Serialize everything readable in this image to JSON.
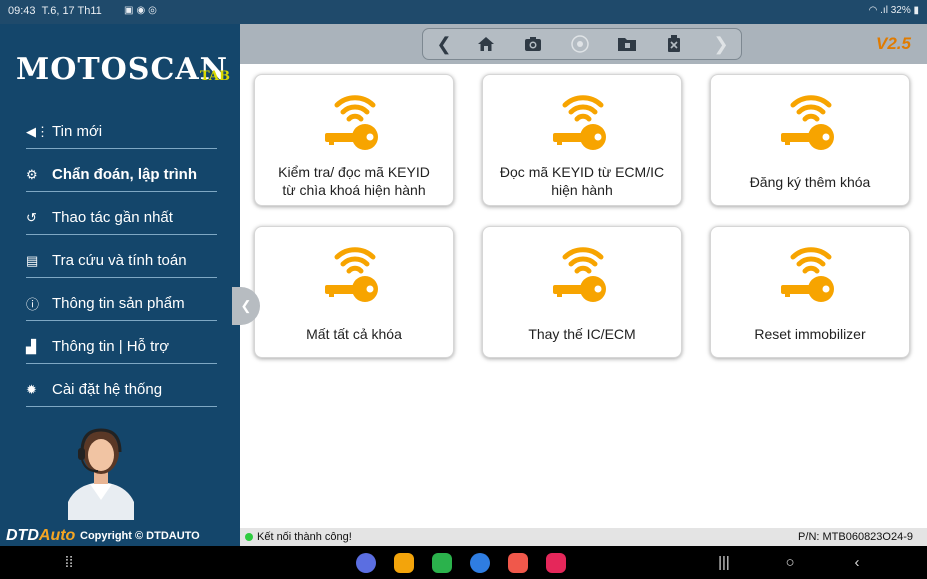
{
  "status_bar": {
    "time": "09:43",
    "date": "T.6, 17 Th11",
    "icons": [
      "image-icon",
      "shield-icon",
      "chrome-icon"
    ],
    "battery": "32%"
  },
  "sidebar": {
    "logo": "MOTOSCAN",
    "logo_sub": "TAB",
    "items": [
      {
        "label": "Tin mới",
        "icon": "megaphone-icon"
      },
      {
        "label": "Chẩn đoán, lập trình",
        "icon": "diagnostic-icon",
        "active": true
      },
      {
        "label": "Thao tác gần nhất",
        "icon": "history-icon"
      },
      {
        "label": "Tra cứu và tính toán",
        "icon": "clipboard-icon"
      },
      {
        "label": "Thông tin sản phẩm",
        "icon": "info-icon"
      },
      {
        "label": "Thông tin | Hỗ trợ",
        "icon": "factory-icon"
      },
      {
        "label": "Cài đặt hệ thống",
        "icon": "gear-icon"
      }
    ],
    "brand_dtd": "DTD",
    "brand_auto": "Auto",
    "copyright": "Copyright © DTDAUTO"
  },
  "toolbar": {
    "buttons": [
      "back-icon",
      "home-icon",
      "camera-icon",
      "record-icon",
      "folder-icon",
      "delete-icon",
      "forward-icon"
    ],
    "version": "V2.5"
  },
  "cards": [
    {
      "label_line1": "Kiểm tra/ đọc mã KEYID",
      "label_line2": "từ chìa khoá hiện hành"
    },
    {
      "label_line1": "Đọc mã KEYID từ ECM/IC",
      "label_line2": "hiện hành"
    },
    {
      "label_line1": "Đăng ký thêm khóa",
      "label_line2": ""
    },
    {
      "label_line1": "Mất tất cả khóa",
      "label_line2": ""
    },
    {
      "label_line1": "Thay thế IC/ECM",
      "label_line2": ""
    },
    {
      "label_line1": "Reset immobilizer",
      "label_line2": ""
    }
  ],
  "status_strip": {
    "connection": "Kết nối thành công!",
    "part_number": "P/N: MTB060823O24-9"
  },
  "colors": {
    "sidebar": "#14466b",
    "key": "#f7a400",
    "version": "#e07b00",
    "connected": "#2ecc40"
  }
}
